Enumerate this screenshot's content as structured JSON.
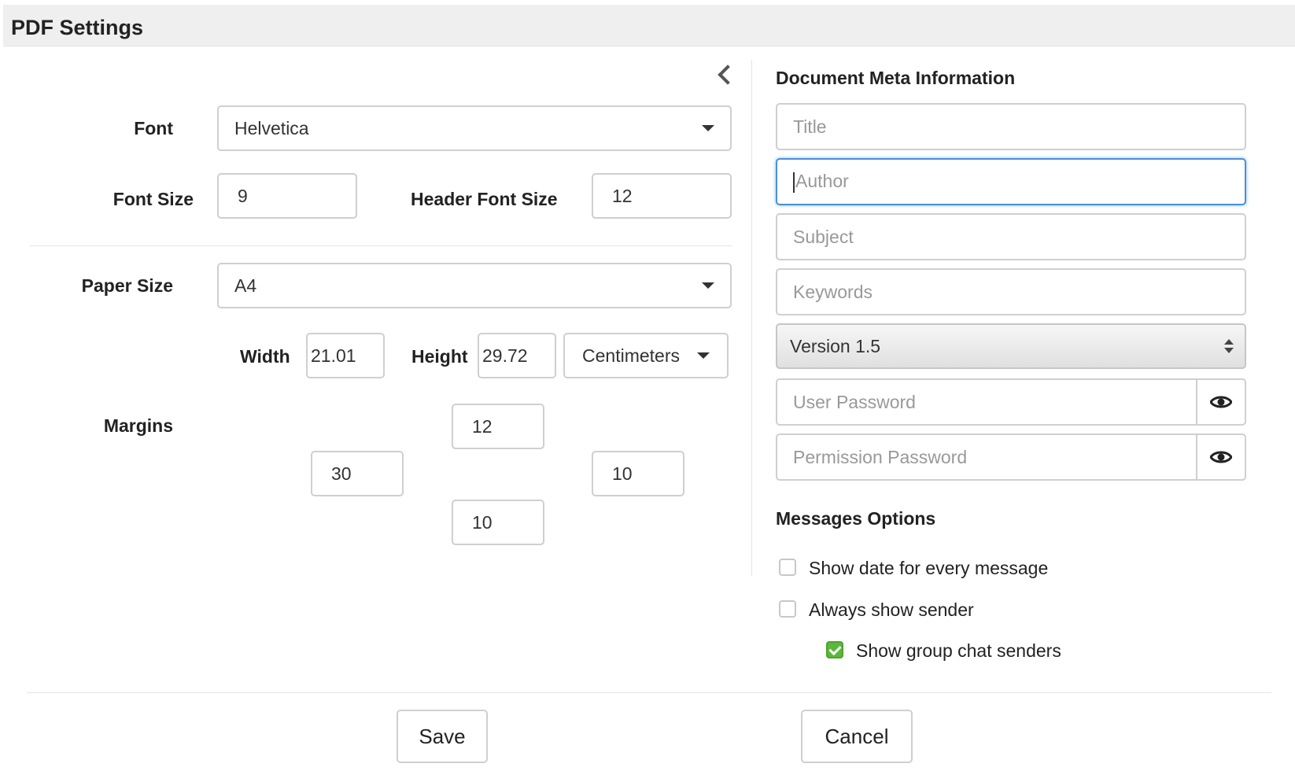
{
  "dialog": {
    "title": "PDF Settings"
  },
  "layout": {
    "font_label": "Font",
    "font_value": "Helvetica",
    "font_size_label": "Font Size",
    "font_size_value": "9",
    "header_font_size_label": "Header Font Size",
    "header_font_size_value": "12",
    "paper_size_label": "Paper Size",
    "paper_size_value": "A4",
    "width_label": "Width",
    "width_value": "21.01",
    "height_label": "Height",
    "height_value": "29.72",
    "unit_value": "Centimeters",
    "margins_label": "Margins",
    "margin_top": "12",
    "margin_left": "30",
    "margin_right": "10",
    "margin_bottom": "10"
  },
  "meta": {
    "heading": "Document Meta Information",
    "title_placeholder": "Title",
    "author_placeholder": "Author",
    "subject_placeholder": "Subject",
    "keywords_placeholder": "Keywords",
    "version_value": "Version 1.5",
    "user_password_placeholder": "User Password",
    "permission_password_placeholder": "Permission Password"
  },
  "messages": {
    "heading": "Messages Options",
    "options": [
      {
        "label": "Show date for every message",
        "checked": false
      },
      {
        "label": "Always show sender",
        "checked": false
      },
      {
        "label": "Show group chat senders",
        "checked": true
      }
    ]
  },
  "footer": {
    "save_label": "Save",
    "cancel_label": "Cancel"
  },
  "colors": {
    "accent_check": "#5cb83c",
    "focus_border": "#4a90d9",
    "header_bg": "#efefef"
  }
}
